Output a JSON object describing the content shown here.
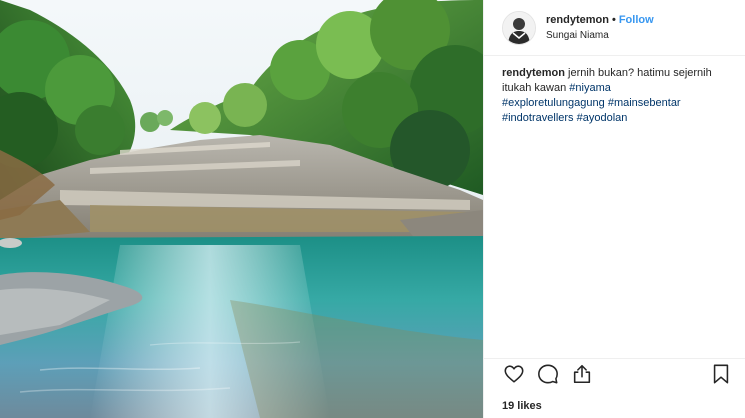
{
  "post": {
    "username": "rendytemon",
    "separator": "•",
    "follow_label": "Follow",
    "location": "Sungai Niama",
    "caption": {
      "username": "rendytemon",
      "line1_text": "jernih bukan? hatimu sejernih",
      "line2_text": "itukah kawan",
      "hashtags": [
        "#niyama",
        "#exploretulungagung",
        "#mainsebentar",
        "#indotravellers",
        "#ayodolan"
      ]
    },
    "likes_text": "19 likes",
    "icons": {
      "like": "heart-icon",
      "comment": "comment-icon",
      "share": "share-icon",
      "save": "bookmark-icon"
    }
  },
  "colors": {
    "accent": "#3897f0",
    "hashtag": "#003569",
    "border": "#efefef",
    "text": "#262626"
  }
}
